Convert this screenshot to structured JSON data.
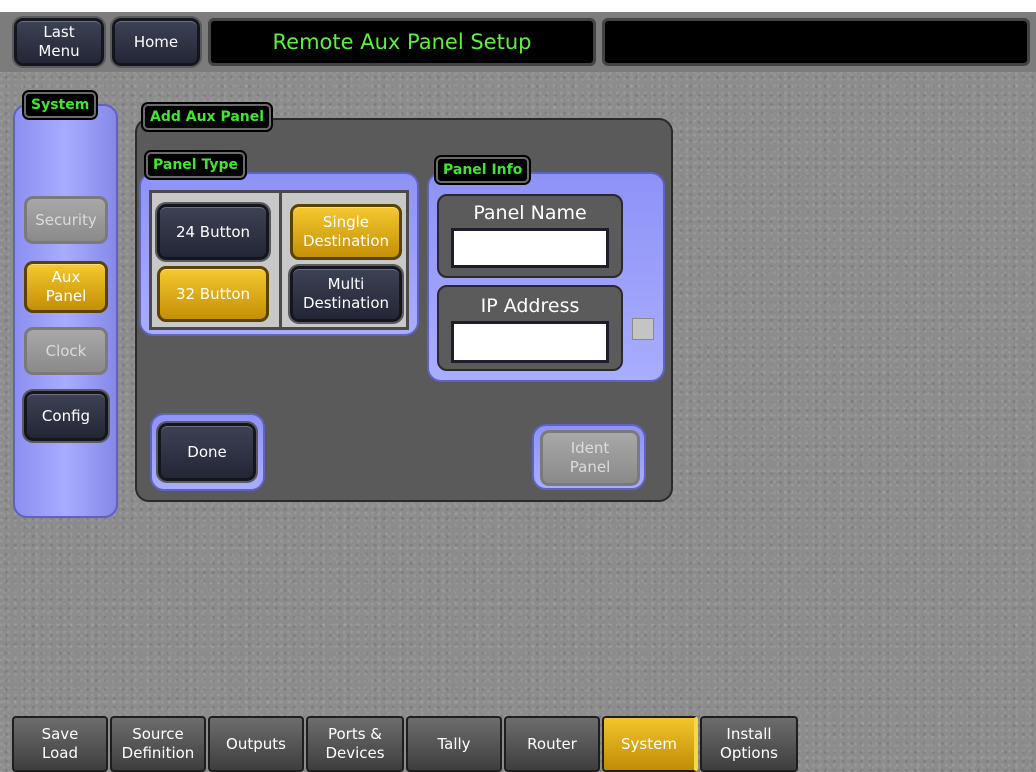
{
  "header": {
    "last_menu": "Last\nMenu",
    "home": "Home",
    "title": "Remote Aux Panel Setup"
  },
  "sidebar": {
    "tag": "System",
    "items": [
      {
        "label": "Security",
        "state": "disabled"
      },
      {
        "label": "Aux\nPanel",
        "state": "active"
      },
      {
        "label": "Clock",
        "state": "disabled"
      },
      {
        "label": "Config",
        "state": "normal"
      }
    ]
  },
  "add_aux_panel": {
    "tag": "Add Aux Panel",
    "panel_type": {
      "tag": "Panel Type",
      "buttons_24": "24 Button",
      "buttons_32": "32 Button",
      "single_destination": "Single\nDestination",
      "multi_destination": "Multi\nDestination"
    },
    "panel_info": {
      "tag": "Panel Info",
      "panel_name_label": "Panel Name",
      "panel_name_value": "",
      "ip_address_label": "IP Address",
      "ip_address_value": ""
    },
    "done": "Done",
    "ident_panel": "Ident\nPanel"
  },
  "bottom_tabs": [
    {
      "label": "Save\nLoad",
      "active": false
    },
    {
      "label": "Source\nDefinition",
      "active": false
    },
    {
      "label": "Outputs",
      "active": false
    },
    {
      "label": "Ports &\nDevices",
      "active": false
    },
    {
      "label": "Tally",
      "active": false
    },
    {
      "label": "Router",
      "active": false
    },
    {
      "label": "System",
      "active": true
    },
    {
      "label": "Install\nOptions",
      "active": false
    }
  ],
  "colors": {
    "accent_gold": "#f4c930",
    "panel_blue": "#a9adff",
    "tag_green": "#3fe82d",
    "title_green": "#5cf23a"
  }
}
